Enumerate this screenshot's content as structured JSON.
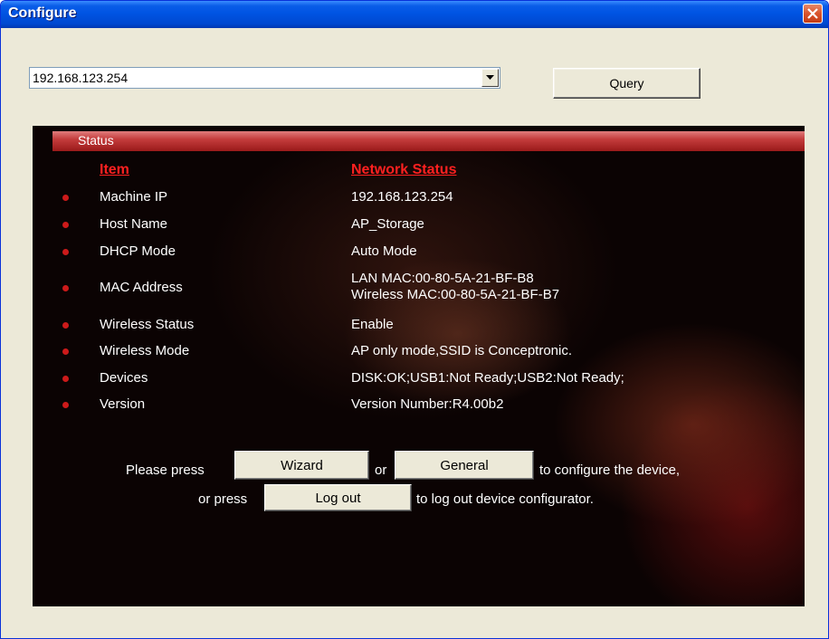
{
  "window": {
    "title": "Configure"
  },
  "address": {
    "value": "192.168.123.254"
  },
  "query_label": "Query",
  "status": {
    "title": "Status",
    "col_item": "Item",
    "col_status": "Network Status",
    "rows": [
      {
        "item": "Machine IP",
        "value": "192.168.123.254"
      },
      {
        "item": "Host Name",
        "value": "AP_Storage"
      },
      {
        "item": "DHCP Mode",
        "value": "Auto Mode"
      },
      {
        "item": "MAC Address",
        "value": "LAN MAC:00-80-5A-21-BF-B8",
        "value2": "Wireless MAC:00-80-5A-21-BF-B7"
      },
      {
        "item": "Wireless Status",
        "value": "Enable"
      },
      {
        "item": "Wireless Mode",
        "value": "AP only mode,SSID is Conceptronic."
      },
      {
        "item": "Devices",
        "value": "DISK:OK;USB1:Not Ready;USB2:Not Ready;"
      },
      {
        "item": "Version",
        "value": "Version Number:R4.00b2"
      }
    ]
  },
  "actions": {
    "please_press": "Please press",
    "wizard": "Wizard",
    "or": "or",
    "general": "General",
    "configure_text": "to configure the device,",
    "or_press": "or press",
    "logout": "Log out",
    "logout_text": "to log out device configurator."
  },
  "colors": {
    "accent_red": "#cc1a1a",
    "titlebar_blue": "#0054e3"
  }
}
